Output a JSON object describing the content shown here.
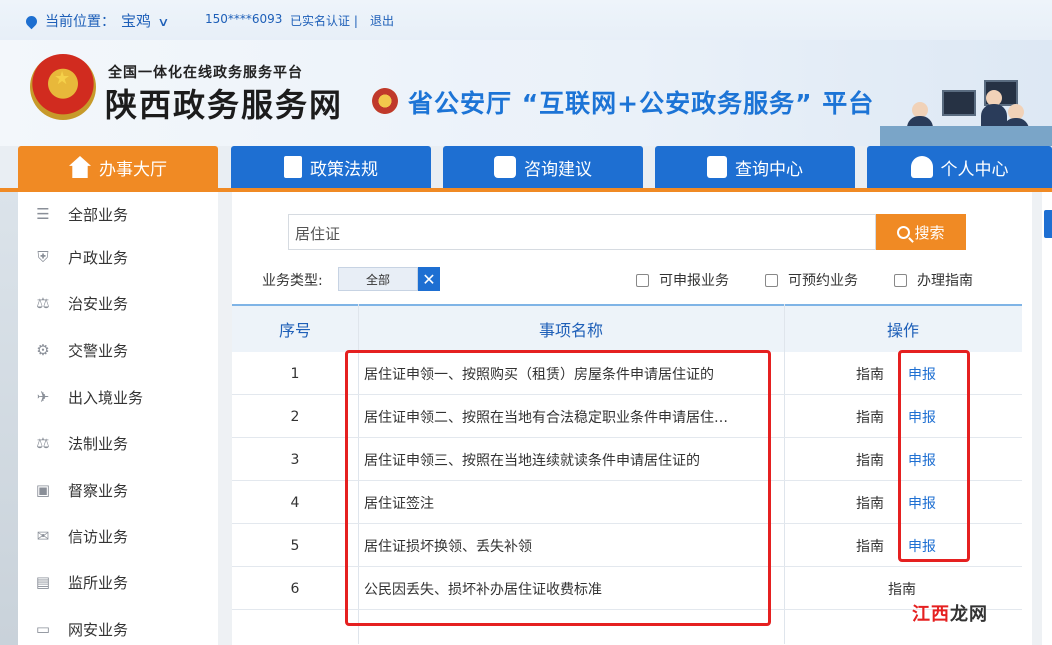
{
  "topbar": {
    "location_label": "当前位置：",
    "city": "宝鸡",
    "phone": "150****6093",
    "verified": "已实名认证 |",
    "logout": "退出"
  },
  "header": {
    "subtitle": "全国一体化在线政务服务平台",
    "title": "陕西政务服务网",
    "platform": "省公安厅 “互联网+公安政务服务” 平台"
  },
  "nav": {
    "tabs": [
      {
        "label": "办事大厅",
        "icon": "home-icon",
        "active": true
      },
      {
        "label": "政策法规",
        "icon": "document-icon",
        "active": false
      },
      {
        "label": "咨询建议",
        "icon": "chat-icon",
        "active": false
      },
      {
        "label": "查询中心",
        "icon": "search-doc-icon",
        "active": false
      },
      {
        "label": "个人中心",
        "icon": "person-icon",
        "active": false
      }
    ],
    "accent_color": "#f08a24",
    "tab_color": "#1e6fd2"
  },
  "sidebar": {
    "items": [
      {
        "label": "全部业务",
        "icon": "list-icon"
      },
      {
        "label": "户政业务",
        "icon": "shield-icon"
      },
      {
        "label": "治安业务",
        "icon": "scale-icon"
      },
      {
        "label": "交警业务",
        "icon": "traffic-icon"
      },
      {
        "label": "出入境业务",
        "icon": "plane-icon"
      },
      {
        "label": "法制业务",
        "icon": "scale-icon"
      },
      {
        "label": "督察业务",
        "icon": "badge-icon"
      },
      {
        "label": "信访业务",
        "icon": "mail-icon"
      },
      {
        "label": "监所业务",
        "icon": "building-icon"
      },
      {
        "label": "网安业务",
        "icon": "monitor-icon"
      }
    ]
  },
  "search": {
    "value": "居住证",
    "button_label": "搜索"
  },
  "filter": {
    "type_label": "业务类型:",
    "type_value": "全部",
    "clear": "✕",
    "checkboxes": [
      "可申报业务",
      "可预约业务",
      "办理指南"
    ]
  },
  "table": {
    "headers": {
      "index": "序号",
      "name": "事项名称",
      "action": "操作"
    },
    "rows": [
      {
        "index": "1",
        "name": "居住证申领一、按照购买（租赁）房屋条件申请居住证的",
        "guide": "指南",
        "apply": "申报"
      },
      {
        "index": "2",
        "name": "居住证申领二、按照在当地有合法稳定职业条件申请居住…",
        "guide": "指南",
        "apply": "申报"
      },
      {
        "index": "3",
        "name": "居住证申领三、按照在当地连续就读条件申请居住证的",
        "guide": "指南",
        "apply": "申报"
      },
      {
        "index": "4",
        "name": "居住证签注",
        "guide": "指南",
        "apply": "申报"
      },
      {
        "index": "5",
        "name": "居住证损坏换领、丢失补领",
        "guide": "指南",
        "apply": "申报"
      },
      {
        "index": "6",
        "name": "公民因丢失、损坏补办居住证收费标准",
        "guide": "指南",
        "apply": ""
      }
    ]
  },
  "watermark": {
    "part1": "江西",
    "part2": "龙网"
  }
}
